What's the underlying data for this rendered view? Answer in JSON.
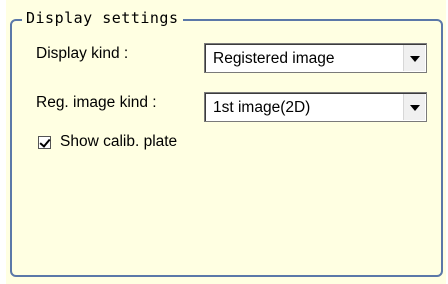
{
  "group": {
    "title": "Display settings"
  },
  "display_kind": {
    "label": "Display kind :",
    "value": "Registered image"
  },
  "reg_image_kind": {
    "label": "Reg. image kind :",
    "value": "1st image(2D)"
  },
  "show_calib_plate": {
    "label": "Show calib. plate",
    "checked": true
  },
  "colors": {
    "panel_background": "#ffffe2",
    "group_border": "#5b78a8"
  }
}
